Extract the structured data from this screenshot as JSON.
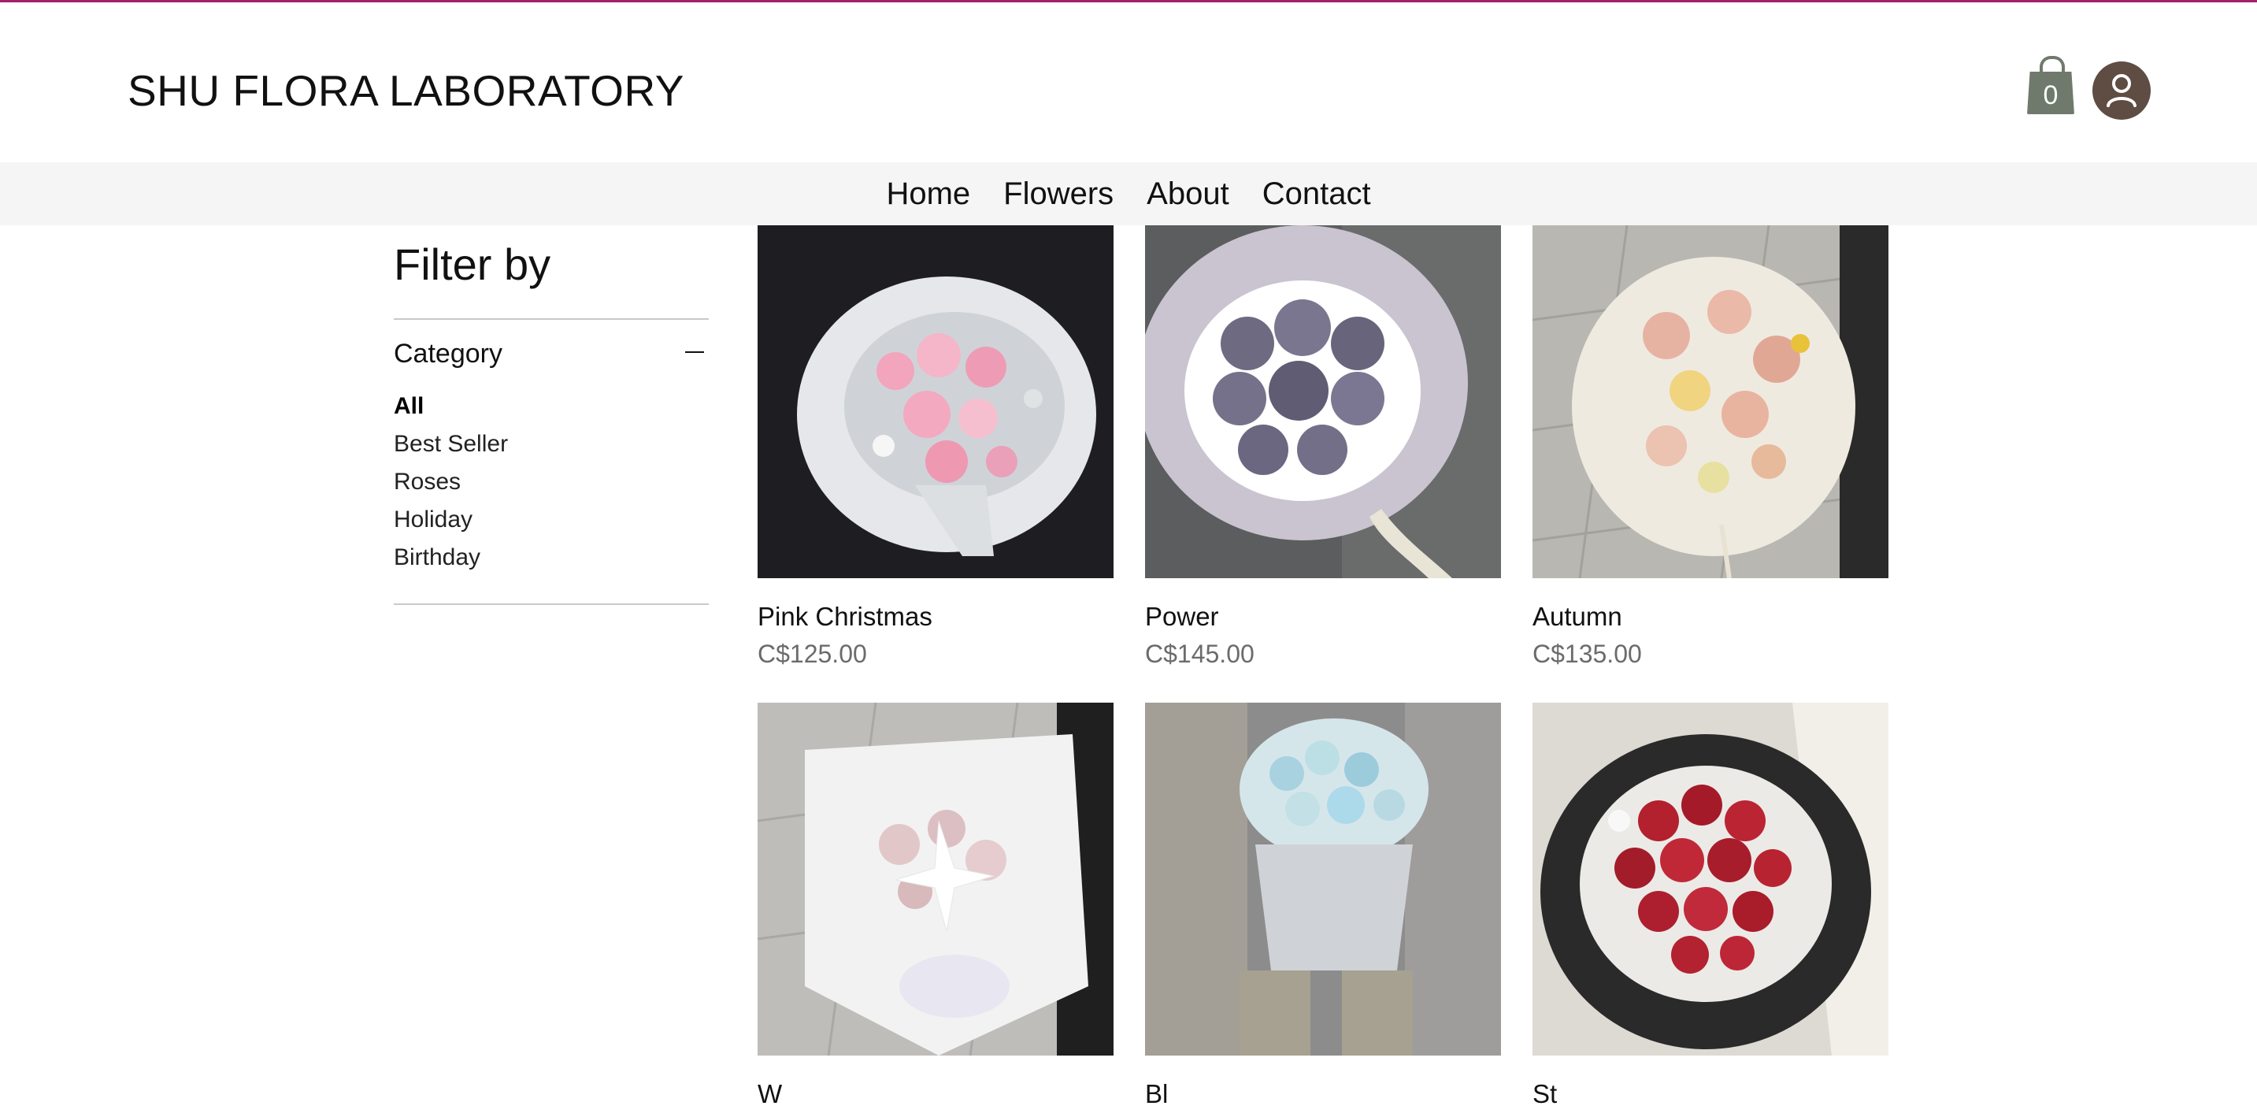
{
  "brand": {
    "title": "SHU FLORA LABORATORY"
  },
  "header": {
    "cart_count": "0",
    "cart_icon": "shopping-bag-icon",
    "user_icon": "user-avatar-icon"
  },
  "nav": {
    "items": [
      {
        "label": "Home"
      },
      {
        "label": "Flowers"
      },
      {
        "label": "About"
      },
      {
        "label": "Contact"
      }
    ]
  },
  "filter": {
    "title": "Filter by",
    "category_label": "Category",
    "categories": [
      {
        "label": "All",
        "active": true
      },
      {
        "label": "Best Seller"
      },
      {
        "label": "Roses"
      },
      {
        "label": "Holiday"
      },
      {
        "label": "Birthday"
      }
    ]
  },
  "products": [
    {
      "name": "Pink Christmas",
      "price": "C$125.00"
    },
    {
      "name": "Power",
      "price": "C$145.00"
    },
    {
      "name": "Autumn",
      "price": "C$135.00"
    },
    {
      "name": "W",
      "price": ""
    },
    {
      "name": "Bl",
      "price": ""
    },
    {
      "name": "St",
      "price": ""
    }
  ],
  "colors": {
    "accent_line": "#a3206b",
    "nav_bg": "#f5f5f5",
    "price": "#6b6b6b"
  }
}
